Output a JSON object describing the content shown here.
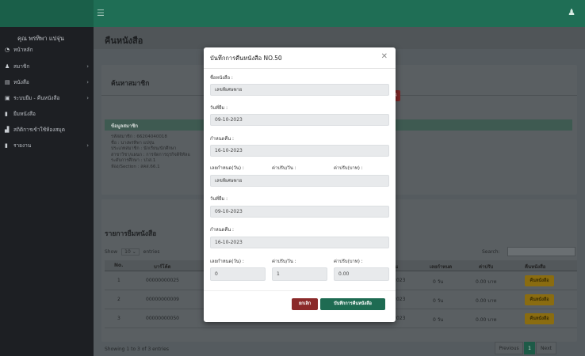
{
  "topbar": {
    "menu_icon": "hamburger-icon",
    "user_icon": "user-icon"
  },
  "sidebar": {
    "user_name": "คุณ พรทิพา แปจุ่น",
    "items": [
      {
        "label": "หน้าหลัก",
        "icon": "dashboard-icon",
        "has_chevron": false
      },
      {
        "label": "สมาชิก",
        "icon": "user-icon",
        "has_chevron": true
      },
      {
        "label": "หนังสือ",
        "icon": "book-icon",
        "has_chevron": true
      },
      {
        "label": "ระบบยืม - คืนหนังสือ",
        "icon": "list-icon",
        "has_chevron": true
      },
      {
        "label": "ยืมหนังสือ",
        "icon": "file-icon",
        "has_chevron": false
      },
      {
        "label": "สถิติการเข้าใช้ห้องสมุด",
        "icon": "chart-icon",
        "has_chevron": false
      },
      {
        "label": "รายงาน",
        "icon": "file-icon",
        "has_chevron": true
      }
    ]
  },
  "main": {
    "page_title": "คืนหนังสือ",
    "search_card_title": "ค้นหาสมาชิก",
    "red_button_label": "ค้",
    "member_info": {
      "title": "ข้อมูลสมาชิก",
      "lines": [
        "รหัสสมาชิก : 66204040018",
        "ชื่อ : นางพรทิพา แปจุ่น",
        "ประเภทสมาชิก : นักเรียน/นักศึกษา",
        "สาขาวิชา/แผนก : การจัดการธุรกิจดิจิทัลแ",
        "ระดับการศึกษา : ปวส.1",
        "ห้อง/Section : สคส.66.1"
      ]
    },
    "borrow_list": {
      "title": "รายการยืมหนังสือ",
      "show_label": "Show",
      "show_value": "10",
      "entries_label": "entries",
      "search_label": "Search:",
      "columns": [
        "No.",
        "บาร์โค้ด",
        "คืน",
        "เลยกำหนด",
        "ค่าปรับ",
        "คืนหนังสือ"
      ],
      "rows": [
        {
          "no": "1",
          "barcode": "00000000025",
          "due": "-2023",
          "late": "0 วัน",
          "fine": "0.00 บาท",
          "action": "คืนหนังสือ"
        },
        {
          "no": "2",
          "barcode": "00000000009",
          "due": "-2023",
          "late": "0 วัน",
          "fine": "0.00 บาท",
          "action": "คืนหนังสือ"
        },
        {
          "no": "3",
          "barcode": "00000000050",
          "due": "-2023",
          "late": "0 วัน",
          "fine": "0.00 บาท",
          "action": "คืนหนังสือ"
        }
      ],
      "footer_info": "Showing 1 to 3 of 3 entries",
      "pager": {
        "previous": "Previous",
        "current": "1",
        "next": "Next"
      }
    }
  },
  "modal": {
    "title": "บันทึกการคืนหนังสือ NO.50",
    "book_name_label": "ชื่อหนังสือ :",
    "book_name_value": "เลขพิเศษพาย",
    "borrow_date_label": "วันที่ยืม :",
    "borrow_date_value": "09-10-2023",
    "due_label": "กำหนดคืน :",
    "due_value": "16-10-2023",
    "row1_labels": [
      "เลยกำหนด(วัน) :",
      "ค่าปรับ/วัน :",
      "ค่าปรับ(บาท) :"
    ],
    "row1_value": "เลขพิเศษพาย",
    "borrow_date2_label": "วันที่ยืม :",
    "borrow_date2_value": "09-10-2023",
    "due2_label": "กำหนดคืน :",
    "due2_value": "16-10-2023",
    "row2_labels": [
      "เลยกำหนด(วัน) :",
      "ค่าปรับ/วัน :",
      "ค่าปรับ(บาท) :"
    ],
    "row2_values": [
      "0",
      "1",
      "0.00"
    ],
    "cancel_label": "ยกเลิก",
    "save_label": "บันทึกการคืนหนังสือ"
  }
}
